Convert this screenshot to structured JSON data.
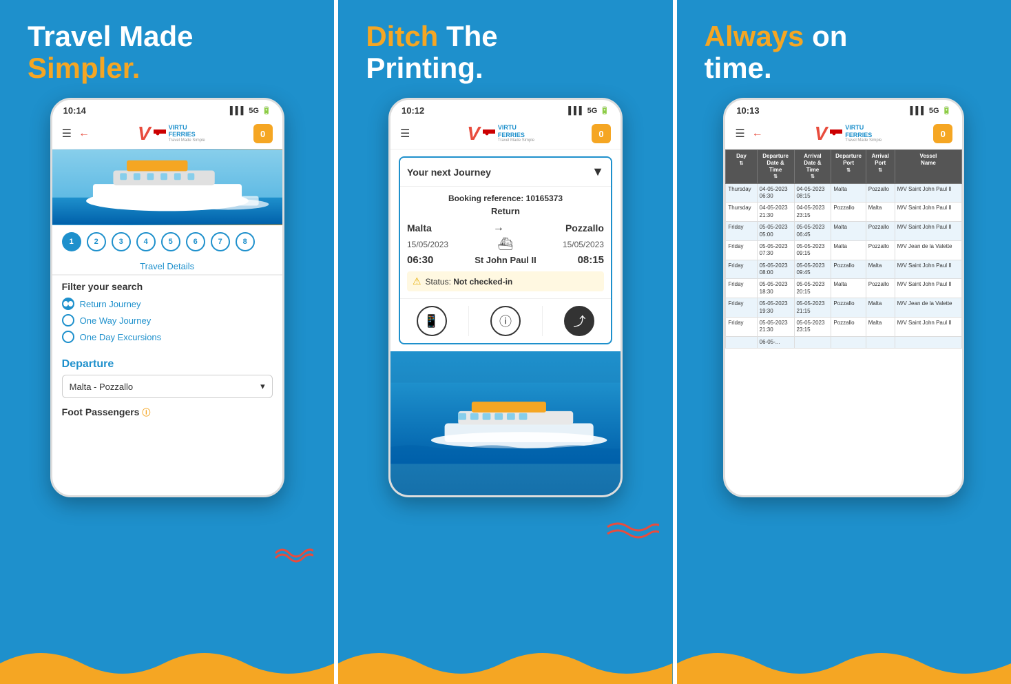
{
  "panels": [
    {
      "id": "panel1",
      "headline_line1": "Travel Made",
      "headline_accent": "Simpler.",
      "status_time": "10:14",
      "status_signal": "▌▌▌",
      "status_network": "5G",
      "header_left": "☰",
      "header_back": "←",
      "logo_v": "V",
      "logo_brand": "VIRTU\nFERRIES",
      "logo_tagline": "Travel Made Simple",
      "chat_badge": "0",
      "pagination": [
        "1",
        "2",
        "3",
        "4",
        "5",
        "6",
        "7",
        "8"
      ],
      "travel_details": "Travel Details",
      "filter_title": "Filter your search",
      "filter_options": [
        {
          "label": "Return Journey",
          "selected": true
        },
        {
          "label": "One Way Journey",
          "selected": false
        },
        {
          "label": "One Day Excursions",
          "selected": false
        }
      ],
      "departure_title": "Departure",
      "departure_value": "Malta - Pozzallo",
      "foot_passengers_title": "Foot Passengers"
    },
    {
      "id": "panel2",
      "headline_word1": "Ditch",
      "headline_rest": " The\nPrinting.",
      "status_time": "10:12",
      "status_signal": "▌▌▌",
      "status_network": "5G",
      "header_left": "☰",
      "logo_v": "V",
      "logo_brand": "VIRTU\nFERRIES",
      "logo_tagline": "Travel Made Simple",
      "chat_badge": "0",
      "journey_header": "Your next Journey",
      "booking_label": "Booking reference:",
      "booking_number": "10165373",
      "journey_type": "Return",
      "origin": "Malta",
      "destination": "Pozzallo",
      "departure_date": "15/05/2023",
      "arrival_date": "15/05/2023",
      "departure_time": "06:30",
      "arrival_time": "08:15",
      "vessel": "St John Paul II",
      "status_label": "Status:",
      "status_value": "Not checked-in"
    },
    {
      "id": "panel3",
      "headline_word1": "Always",
      "headline_rest": " on\ntime.",
      "status_time": "10:13",
      "status_signal": "▌▌▌",
      "status_network": "5G",
      "header_left": "☰",
      "header_back": "←",
      "logo_v": "V",
      "logo_brand": "VIRTU\nFERRIES",
      "logo_tagline": "Travel Made Simple",
      "chat_badge": "0",
      "table_headers": [
        "Day",
        "Departure\nDate &\nTime",
        "Arrival\nDate &\nTime",
        "Departure\nPort",
        "Arrival\nPort",
        "Vessel\nName"
      ],
      "table_rows": [
        [
          "Thursday",
          "04-05-2023\n06:30",
          "04-05-2023\n08:15",
          "Malta",
          "Pozzallo",
          "M/V Saint John Paul II"
        ],
        [
          "Thursday",
          "04-05-2023\n21:30",
          "04-05-2023\n23:15",
          "Pozzallo",
          "Malta",
          "M/V Saint John Paul II"
        ],
        [
          "Friday",
          "05-05-2023\n05:00",
          "05-05-2023\n06:45",
          "Malta",
          "Pozzallo",
          "M/V Saint John Paul II"
        ],
        [
          "Friday",
          "05-05-2023\n07:30",
          "05-05-2023\n09:15",
          "Malta",
          "Pozzallo",
          "M/V Jean de la Valette"
        ],
        [
          "Friday",
          "05-05-2023\n08:00",
          "05-05-2023\n09:45",
          "Pozzallo",
          "Malta",
          "M/V Saint John Paul II"
        ],
        [
          "Friday",
          "05-05-2023\n18:30",
          "05-05-2023\n20:15",
          "Malta",
          "Pozzallo",
          "M/V Saint John Paul II"
        ],
        [
          "Friday",
          "05-05-2023\n19:30",
          "05-05-2023\n21:15",
          "Pozzallo",
          "Malta",
          "M/V Jean de la Valette"
        ],
        [
          "Friday",
          "05-05-2023\n21:30",
          "05-05-2023\n23:15",
          "Pozzallo",
          "Malta",
          "M/V Saint John Paul II"
        ],
        [
          "",
          "06-05-...",
          "",
          "",
          "",
          ""
        ]
      ]
    }
  ]
}
